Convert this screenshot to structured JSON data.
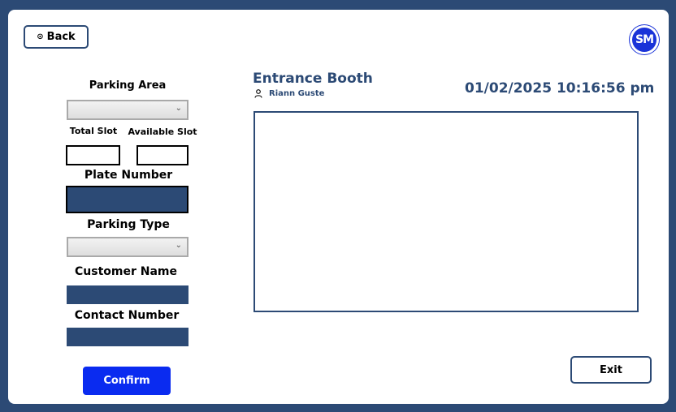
{
  "header": {
    "back_label": "Back",
    "logo_text": "SM"
  },
  "form": {
    "parking_area_label": "Parking Area",
    "parking_area_value": "",
    "total_slot_label": "Total Slot",
    "total_slot_value": "",
    "available_slot_label": "Available Slot",
    "available_slot_value": "",
    "plate_number_label": "Plate Number",
    "plate_number_value": "",
    "parking_type_label": "Parking Type",
    "parking_type_value": "",
    "customer_name_label": "Customer Name",
    "customer_name_value": "",
    "contact_number_label": "Contact Number",
    "contact_number_value": "",
    "confirm_label": "Confirm"
  },
  "booth": {
    "title": "Entrance Booth",
    "user_name": "Riann Guste",
    "datetime": "01/02/2025 10:16:56 pm"
  },
  "footer": {
    "exit_label": "Exit"
  },
  "colors": {
    "primary": "#2c4a75",
    "confirm": "#0a2bf0",
    "logo": "#1a33d8"
  }
}
